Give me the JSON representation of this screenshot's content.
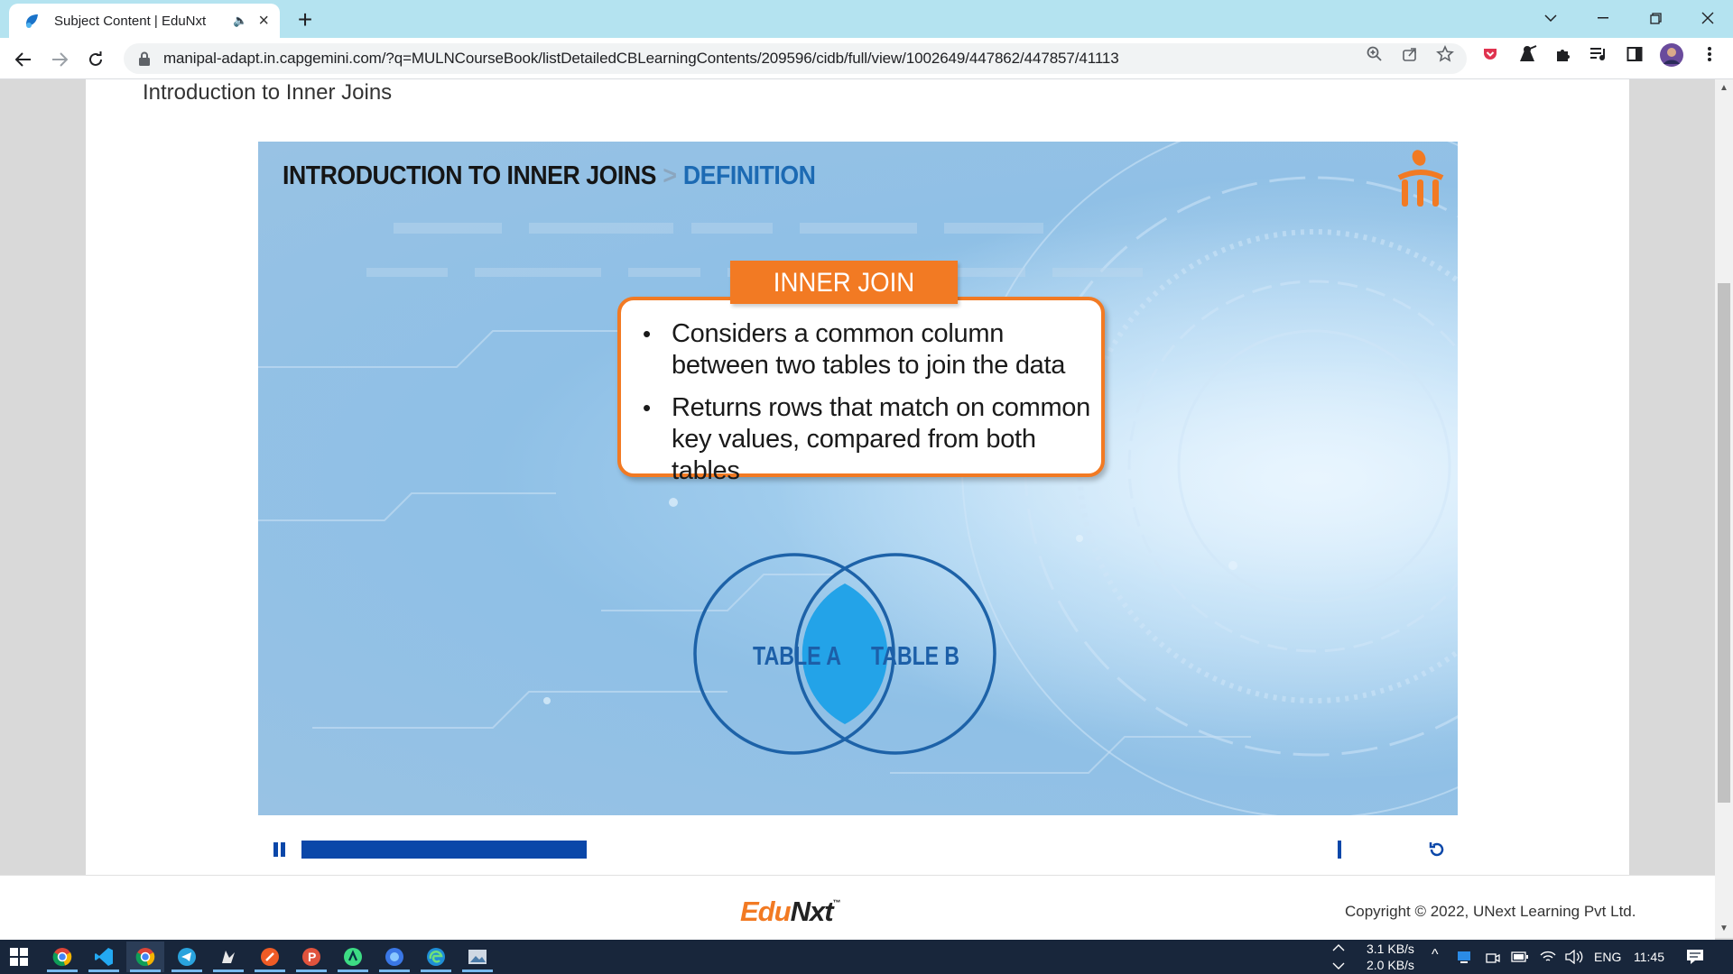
{
  "browser": {
    "tab_title": "Subject Content | EduNxt",
    "url": "manipal-adapt.in.capgemini.com/?q=MULNCourseBook/listDetailedCBLearningContents/209596/cidb/full/view/1002649/447862/447857/41113"
  },
  "page": {
    "section_title": "Introduction to Inner Joins"
  },
  "slide": {
    "title_main": "INTRODUCTION TO INNER JOINS",
    "title_sep": ">",
    "title_sub": "DEFINITION",
    "callout_heading": "INNER JOIN",
    "bullets": [
      "Considers a common column between two tables to join the data",
      "Returns rows that match on common key values, compared from both tables"
    ],
    "venn_left": "TABLE A",
    "venn_right": "TABLE B"
  },
  "player": {
    "progress_fraction": 0.24
  },
  "footer": {
    "logo_edu": "Edu",
    "logo_nxt": "Nxt",
    "logo_tm": "™",
    "copyright": "Copyright © 2022, UNext Learning Pvt Ltd."
  },
  "taskbar": {
    "net_up": "3.1 KB/s",
    "net_down": "2.0 KB/s",
    "language": "ENG",
    "time": "11:45"
  },
  "colors": {
    "accent_orange": "#f27a23",
    "player_blue": "#0a47a9",
    "venn_fill": "#23a3e8",
    "venn_stroke": "#1d62a8",
    "title_blue": "#1c6ab3"
  }
}
